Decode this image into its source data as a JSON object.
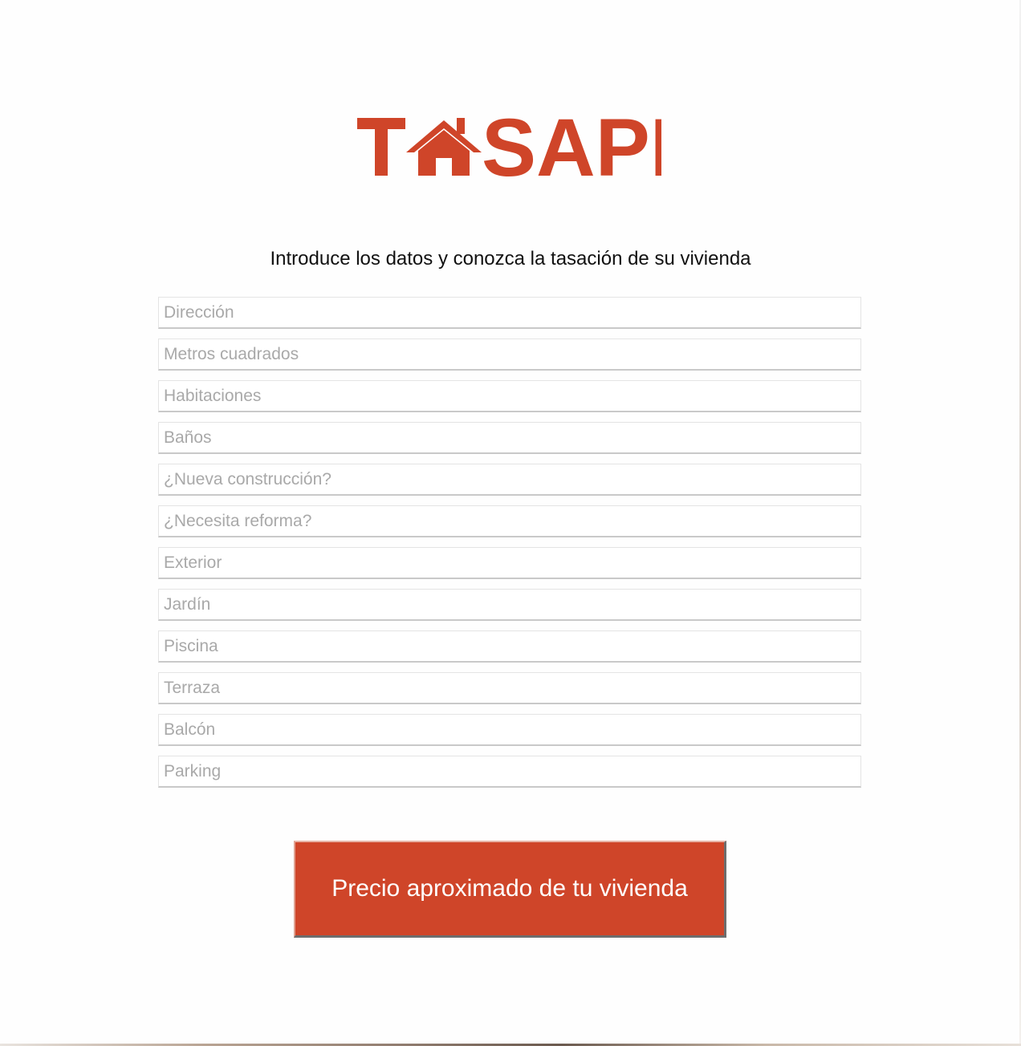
{
  "brand": {
    "name": "TASAPI",
    "color": "#cf4529"
  },
  "intro": "Introduce los datos y conozca la tasación de su vivienda",
  "form": {
    "fields": [
      {
        "name": "direccion",
        "placeholder": "Dirección",
        "value": ""
      },
      {
        "name": "metros",
        "placeholder": "Metros cuadrados",
        "value": ""
      },
      {
        "name": "habitaciones",
        "placeholder": "Habitaciones",
        "value": ""
      },
      {
        "name": "banos",
        "placeholder": "Baños",
        "value": ""
      },
      {
        "name": "nueva-construccion",
        "placeholder": "¿Nueva construcción?",
        "value": ""
      },
      {
        "name": "reforma",
        "placeholder": "¿Necesita reforma?",
        "value": ""
      },
      {
        "name": "exterior",
        "placeholder": "Exterior",
        "value": ""
      },
      {
        "name": "jardin",
        "placeholder": "Jardín",
        "value": ""
      },
      {
        "name": "piscina",
        "placeholder": "Piscina",
        "value": ""
      },
      {
        "name": "terraza",
        "placeholder": "Terraza",
        "value": ""
      },
      {
        "name": "balcon",
        "placeholder": "Balcón",
        "value": ""
      },
      {
        "name": "parking",
        "placeholder": "Parking",
        "value": ""
      }
    ],
    "submit_label": "Precio aproximado de tu vivienda"
  },
  "icons": {
    "logo_house": "house-icon"
  }
}
